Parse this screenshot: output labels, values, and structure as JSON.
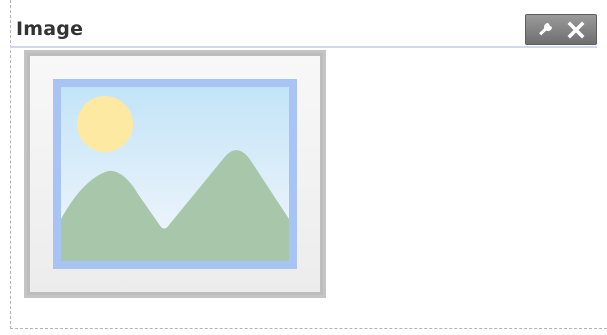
{
  "widget": {
    "title": "Image"
  },
  "toolbar": {
    "icons": [
      "wrench-icon",
      "close-icon"
    ]
  },
  "colors": {
    "sky_top": "#c3e4f8",
    "sky_bottom": "#f4f7fb",
    "frame_border": "#a8c4f5",
    "mountain": "#a8c7aa",
    "sun": "#fde9a2",
    "header_rule": "#d3d8e8"
  }
}
